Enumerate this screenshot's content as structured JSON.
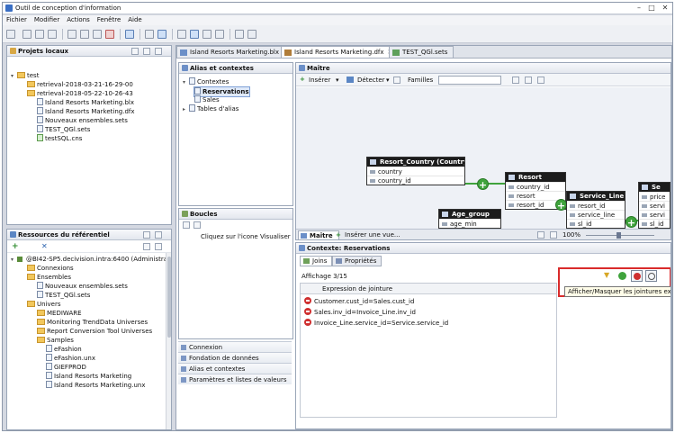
{
  "window": {
    "title": "Outil de conception d'information"
  },
  "menu": [
    "Fichier",
    "Modifier",
    "Actions",
    "Fenêtre",
    "Aide"
  ],
  "local_projects": {
    "title": "Projets locaux",
    "items": [
      "test",
      "retrieval-2018-03-21-16-29-00",
      "retrieval-2018-05-22-10-26-43",
      "Island Resorts Marketing.blx",
      "Island Resorts Marketing.dfx",
      "Nouveaux ensembles.sets",
      "TEST_QGl.sets",
      "testSQL.cns"
    ]
  },
  "repository": {
    "title": "Ressources du référentiel",
    "items": [
      "@BI42-SP5.decivision.intra:6400 (Administrat",
      "Connexions",
      "Ensembles",
      "Nouveaux ensembles.sets",
      "TEST_QGl.sets",
      "Univers",
      "MEDIWARE",
      "Monitoring TrendData Universes",
      "Report Conversion Tool Universes",
      "Samples",
      "eFashion",
      "eFashion.unx",
      "GIEFPROD",
      "Island Resorts Marketing",
      "Island Resorts Marketing.unx"
    ]
  },
  "editor_tabs": [
    {
      "label": "Island Resorts Marketing.blx",
      "close": ""
    },
    {
      "label": "Island Resorts Marketing.dfx",
      "close": "✕"
    },
    {
      "label": "TEST_QGl.sets",
      "close": ""
    }
  ],
  "alias": {
    "title": "Alias et contextes",
    "contexts_label": "Contextes",
    "contexts": [
      "Reservations",
      "Sales"
    ],
    "alias_tables": "Tables d'alias"
  },
  "boucles": {
    "title": "Boucles",
    "hint": "Cliquez sur l'icone Visualiser les"
  },
  "nav": [
    "Connexion",
    "Fondation de données",
    "Alias et contextes",
    "Paramètres et listes de valeurs"
  ],
  "master": {
    "title": "Maître",
    "insert": "Insérer",
    "detect": "Détecter",
    "families": "Familles",
    "tab_master": "Maître",
    "tab_insert_view": "Insérer une vue...",
    "zoom": "100%"
  },
  "entities": {
    "resort_country": {
      "title": "Resort_Country (Country)",
      "rows": [
        "country",
        "country_id"
      ]
    },
    "resort": {
      "title": "Resort",
      "rows": [
        "country_id",
        "resort",
        "resort_id"
      ]
    },
    "service_line": {
      "title": "Service_Line",
      "rows": [
        "resort_id",
        "service_line",
        "sl_id"
      ]
    },
    "age_group": {
      "title": "Age_group",
      "rows": [
        "age_min"
      ]
    },
    "service": {
      "title": "Se",
      "rows": [
        "price",
        "servi",
        "servi",
        "sl_id"
      ]
    }
  },
  "context": {
    "title": "Contexte: Reservations",
    "tab_joins": "Joins",
    "tab_properties": "Propriétés",
    "display": "Affichage 3/15",
    "column": "Expression de jointure",
    "joins": [
      "Customer.cust_id=Sales.cust_id",
      "Sales.inv_id=Invoice_Line.inv_id",
      "Invoice_Line.service_id=Service.service_id"
    ],
    "tooltip": "Afficher/Masquer les jointures exclues"
  },
  "colors": {
    "highlight": "#d92b2b",
    "entity_header": "#1c1c1c",
    "join_plus": "#3fa33c"
  }
}
